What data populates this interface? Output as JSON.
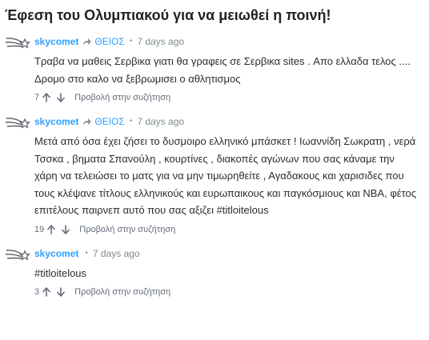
{
  "page": {
    "title": "Έφεση του Ολυμπιακού για να μειωθεί η ποινή!"
  },
  "comments": [
    {
      "author": "skycomet",
      "reply_to": "ΘΕΙΟΣ",
      "time": "7 days ago",
      "body": "Τραβα να μαθεις Σερβικα γιατι θα γραφεις σε Σερβικα sites . Απο ελλαδα τελος .... Δρομο στο καλο να ξεβρωμισει ο αθλητισμος",
      "votes": "7",
      "view_label": "Προβολή στην συζήτηση"
    },
    {
      "author": "skycomet",
      "reply_to": "ΘΕΙΟΣ",
      "time": "7 days ago",
      "body": "Μετά από όσα έχει ζήσει το δυσμοιρο ελληνικό μπάσκετ ! Ιωαννίδη Σωκρατη , νερά Τσσκα , βηματα Σπανούλη , κουρτίνες , διακοπές αγώνων που σας κάναμε την χάρη να τελειώσει το ματς για να μην τιμωρηθείτε , Αγαδακους και χαρισιδες που τους κλέψανε τίτλους ελληνικούς και ευρωπαικους και παγκόσμιους και NBA, φέτος επιτέλους παιρνεπ αυτό που σας αξιζει #titloitelous",
      "votes": "19",
      "view_label": "Προβολή στην συζήτηση"
    },
    {
      "author": "skycomet",
      "reply_to": "",
      "time": "7 days ago",
      "body": "#titloitelous",
      "votes": "3",
      "view_label": "Προβολή στην συζήτηση"
    }
  ],
  "colors": {
    "link": "#2e9fff",
    "meta": "#7f8a91",
    "text": "#2a2e2e"
  },
  "icons": {
    "avatar": "comet-avatar-icon",
    "reply": "reply-arrow-icon",
    "upvote": "arrow-up-icon",
    "downvote": "arrow-down-icon"
  }
}
